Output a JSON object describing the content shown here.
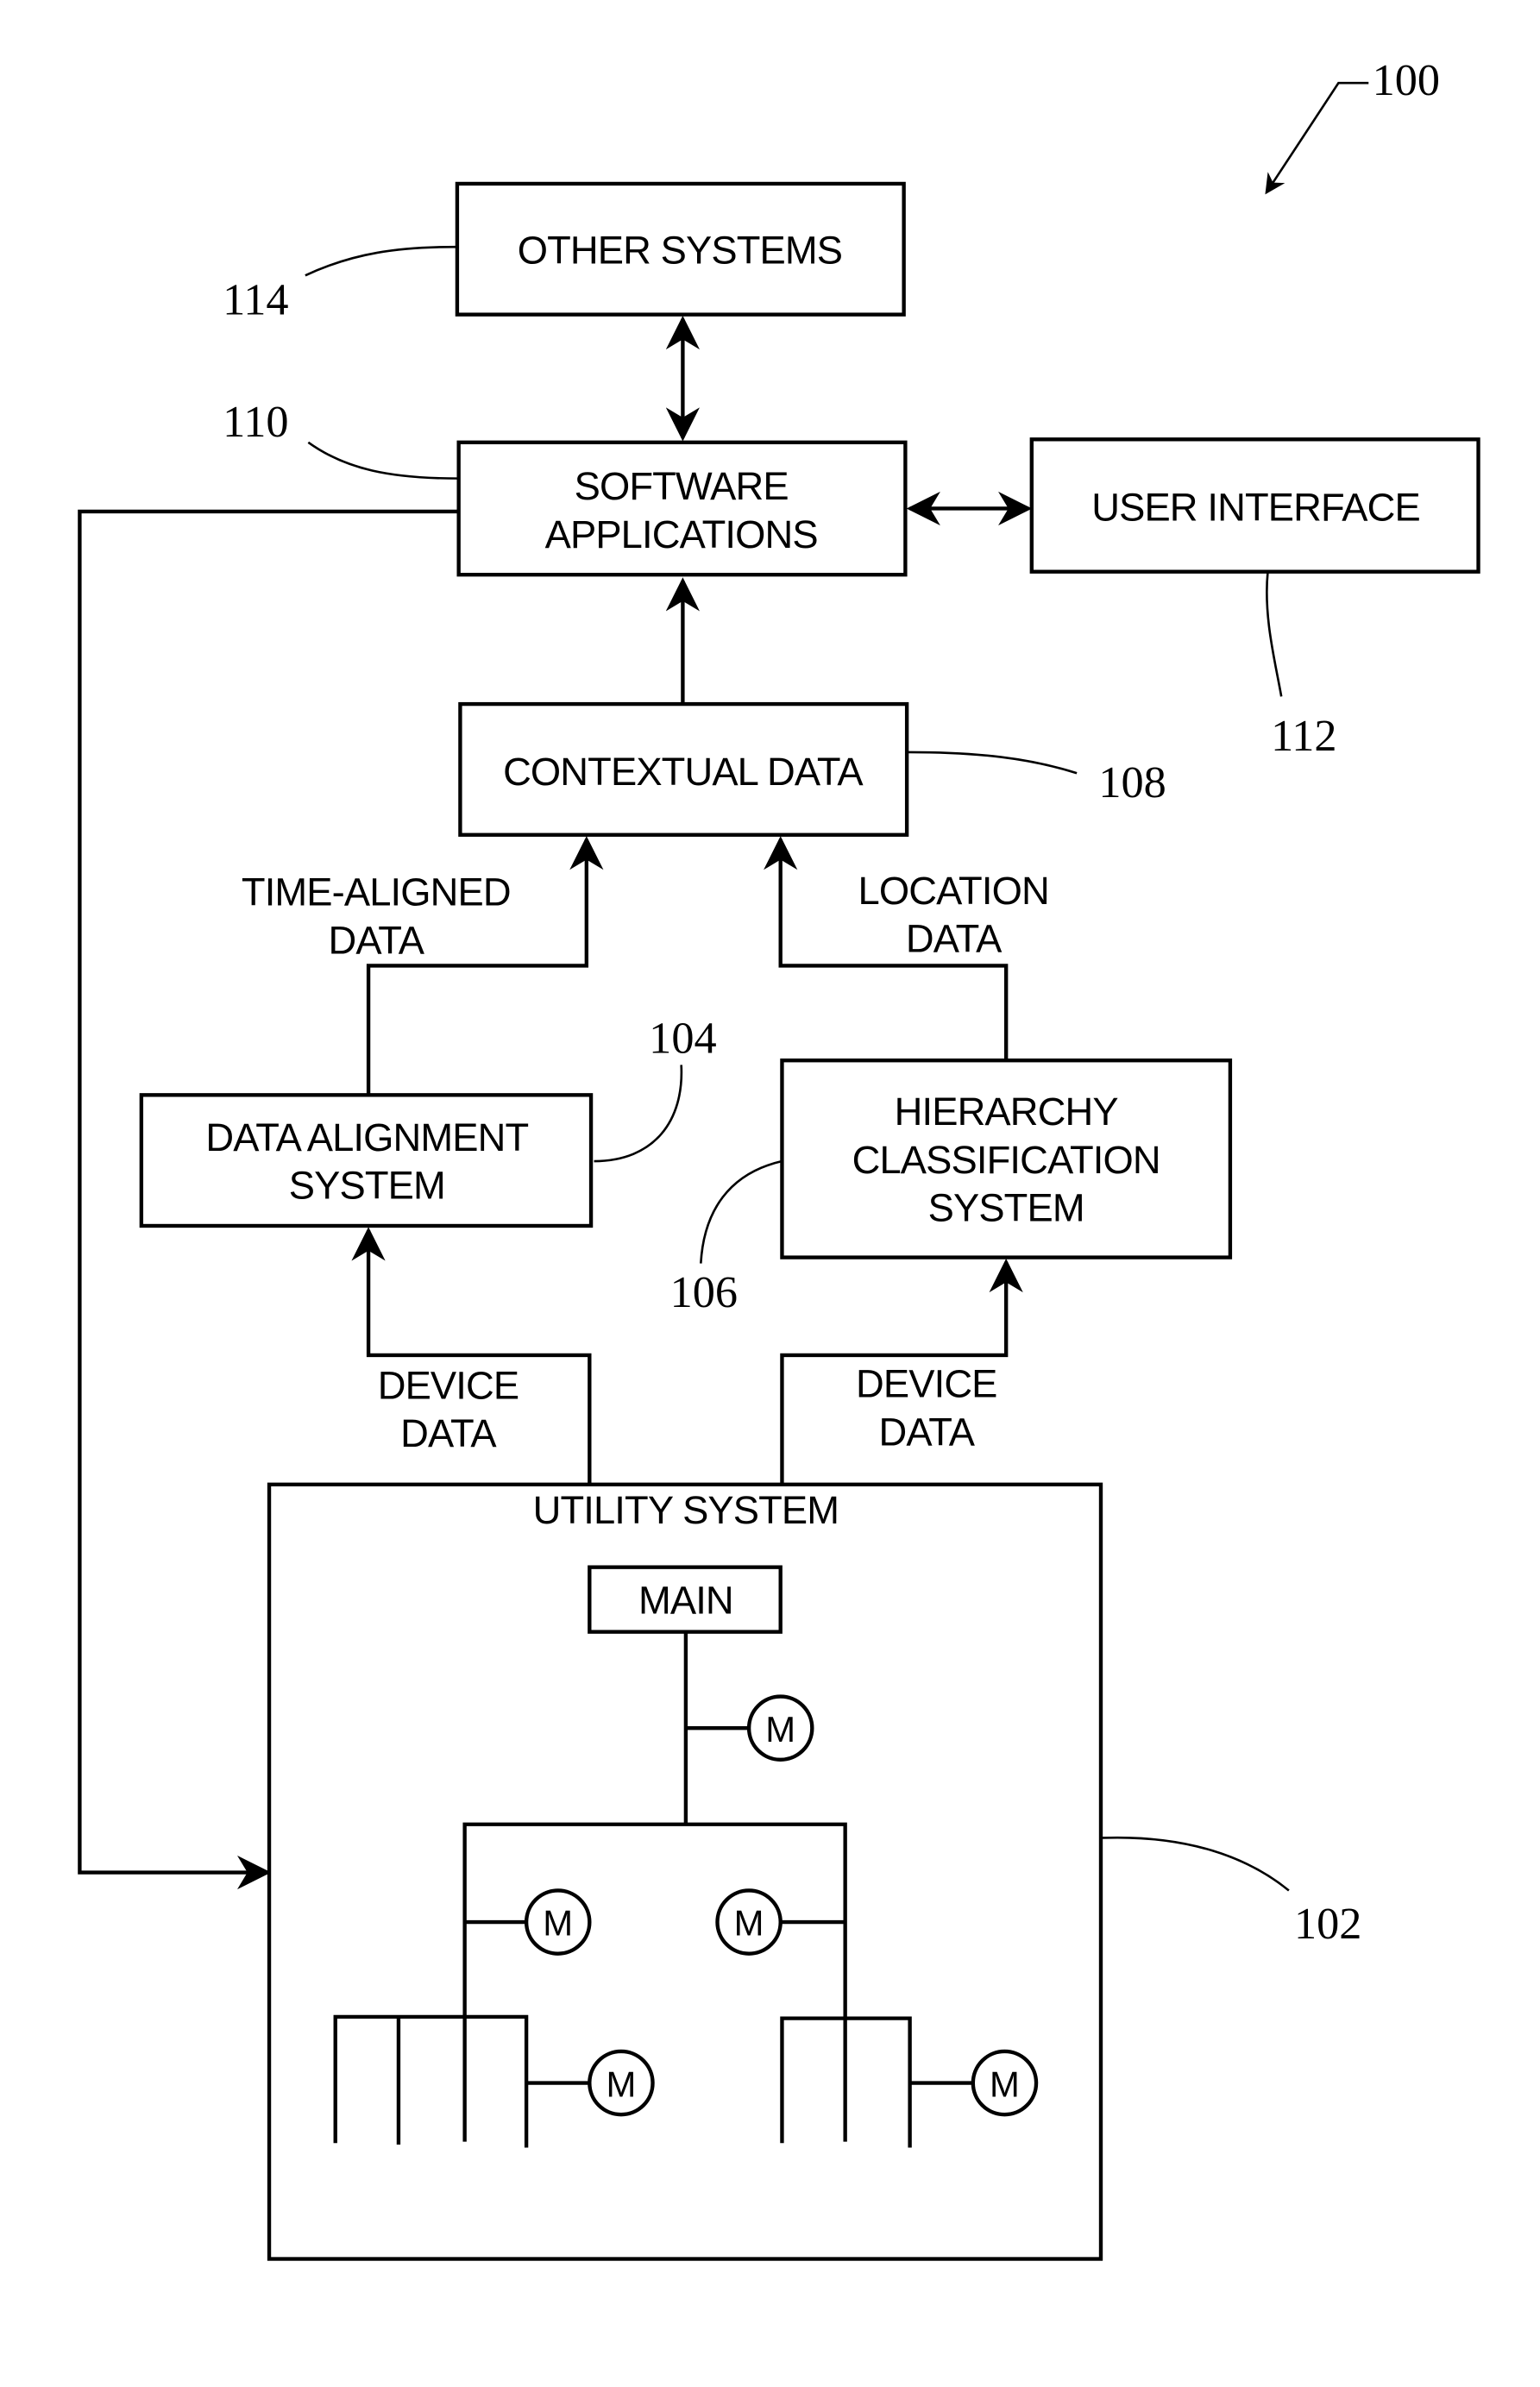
{
  "figure": {
    "reference": "100",
    "background": "#ffffff",
    "ink": "#000000"
  },
  "blocks": {
    "other_systems": {
      "label": "OTHER SYSTEMS",
      "ref": "114"
    },
    "software_applications": {
      "label_lines": [
        "SOFTWARE",
        "APPLICATIONS"
      ],
      "ref": "110"
    },
    "user_interface": {
      "label": "USER INTERFACE",
      "ref": "112"
    },
    "contextual_data": {
      "label": "CONTEXTUAL DATA",
      "ref": "108"
    },
    "data_alignment_system": {
      "label_lines": [
        "DATA ALIGNMENT",
        "SYSTEM"
      ],
      "ref": "104"
    },
    "hierarchy_classification_system": {
      "label_lines": [
        "HIERARCHY",
        "CLASSIFICATION",
        "SYSTEM"
      ],
      "ref": "106"
    },
    "utility_system": {
      "label": "UTILITY SYSTEM",
      "ref": "102",
      "main_label": "MAIN",
      "meter_label": "M"
    }
  },
  "flows": {
    "time_aligned": [
      "TIME-ALIGNED",
      "DATA"
    ],
    "location": [
      "LOCATION",
      "DATA"
    ],
    "device_left": [
      "DEVICE",
      "DATA"
    ],
    "device_right": [
      "DEVICE",
      "DATA"
    ]
  }
}
